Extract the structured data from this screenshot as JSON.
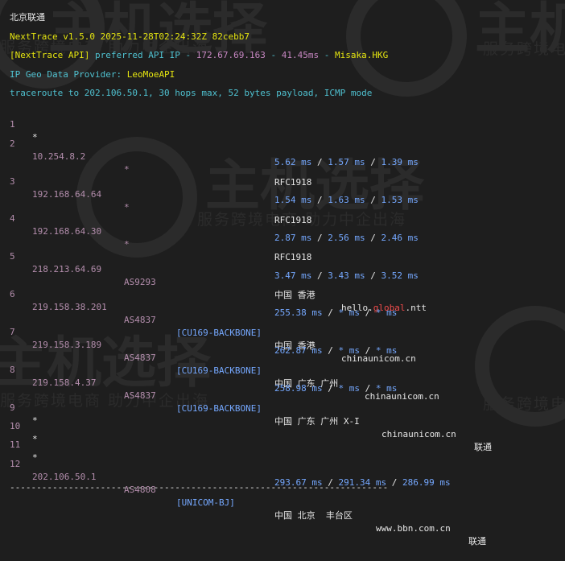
{
  "watermark": {
    "brand": "主机选择",
    "slogan": "服务跨境电商 助力中企出海"
  },
  "header": {
    "region_title": "北京联通",
    "version_line": "NextTrace v1.5.0 2025-11-28T02:24:32Z 82cebb7",
    "api_tag": "[NextTrace API]",
    "api_text": " preferred API IP - ",
    "api_ip": "172.67.69.163",
    "api_latency": "41.45ms",
    "api_node": "Misaka.HKG",
    "geo_label": "IP Geo Data Provider:",
    "geo_value": "LeoMoeAPI",
    "traceroute_line": "traceroute to 202.106.50.1, 30 hops max, 52 bytes payload, ICMP mode"
  },
  "hops": [
    {
      "num": "1",
      "ip": "*"
    },
    {
      "num": "2",
      "ip": "10.254.8.2",
      "as": "*",
      "geo": "RFC1918",
      "rtt": [
        "5.62 ms",
        "1.57 ms",
        "1.39 ms"
      ]
    },
    {
      "num": "3",
      "ip": "192.168.64.64",
      "as": "*",
      "geo": "RFC1918",
      "rtt": [
        "1.54 ms",
        "1.63 ms",
        "1.53 ms"
      ]
    },
    {
      "num": "4",
      "ip": "192.168.64.30",
      "as": "*",
      "geo": "RFC1918",
      "rtt": [
        "2.87 ms",
        "2.56 ms",
        "2.46 ms"
      ]
    },
    {
      "num": "5",
      "ip": "218.213.64.69",
      "as": "AS9293",
      "geo": "中国 香港",
      "host_pre": "hello.",
      "host_hl": "global",
      "host_post": ".ntt",
      "rtt": [
        "3.47 ms",
        "3.43 ms",
        "3.52 ms"
      ]
    },
    {
      "num": "6",
      "ip": "219.158.38.201",
      "as": "AS4837",
      "tag": "[CU169-BACKBONE]",
      "geo": "中国 香港",
      "host": "chinaunicom.cn",
      "rtt": [
        "255.38 ms",
        "* ms",
        "* ms"
      ]
    },
    {
      "num": "7",
      "ip": "219.158.3.189",
      "as": "AS4837",
      "tag": "[CU169-BACKBONE]",
      "geo": "中国 广东 广州",
      "host": "chinaunicom.cn",
      "rtt": [
        "262.87 ms",
        "* ms",
        "* ms"
      ]
    },
    {
      "num": "8",
      "ip": "219.158.4.37",
      "as": "AS4837",
      "tag": "[CU169-BACKBONE]",
      "geo": "中国 广东 广州 X-I",
      "host": "chinaunicom.cn",
      "isp": "联通",
      "rtt": [
        "258.98 ms",
        "* ms",
        "* ms"
      ]
    },
    {
      "num": "9",
      "ip": "*"
    },
    {
      "num": "10",
      "ip": "*"
    },
    {
      "num": "11",
      "ip": "*"
    },
    {
      "num": "12",
      "ip": "202.106.50.1",
      "as": "AS4808",
      "tag": "[UNICOM-BJ]",
      "geo": "中国 北京  丰台区",
      "host": "www.bbn.com.cn",
      "isp": "联通",
      "rtt": [
        "293.67 ms",
        "291.34 ms",
        "286.99 ms"
      ]
    }
  ],
  "separator": "-----------------------------------------------------------------------",
  "colors": {
    "background": "#1e1e1e",
    "ip": "#b48ead",
    "rtt": "#75a8ff",
    "version": "#e5e510",
    "highlight": "#f14c4c"
  }
}
